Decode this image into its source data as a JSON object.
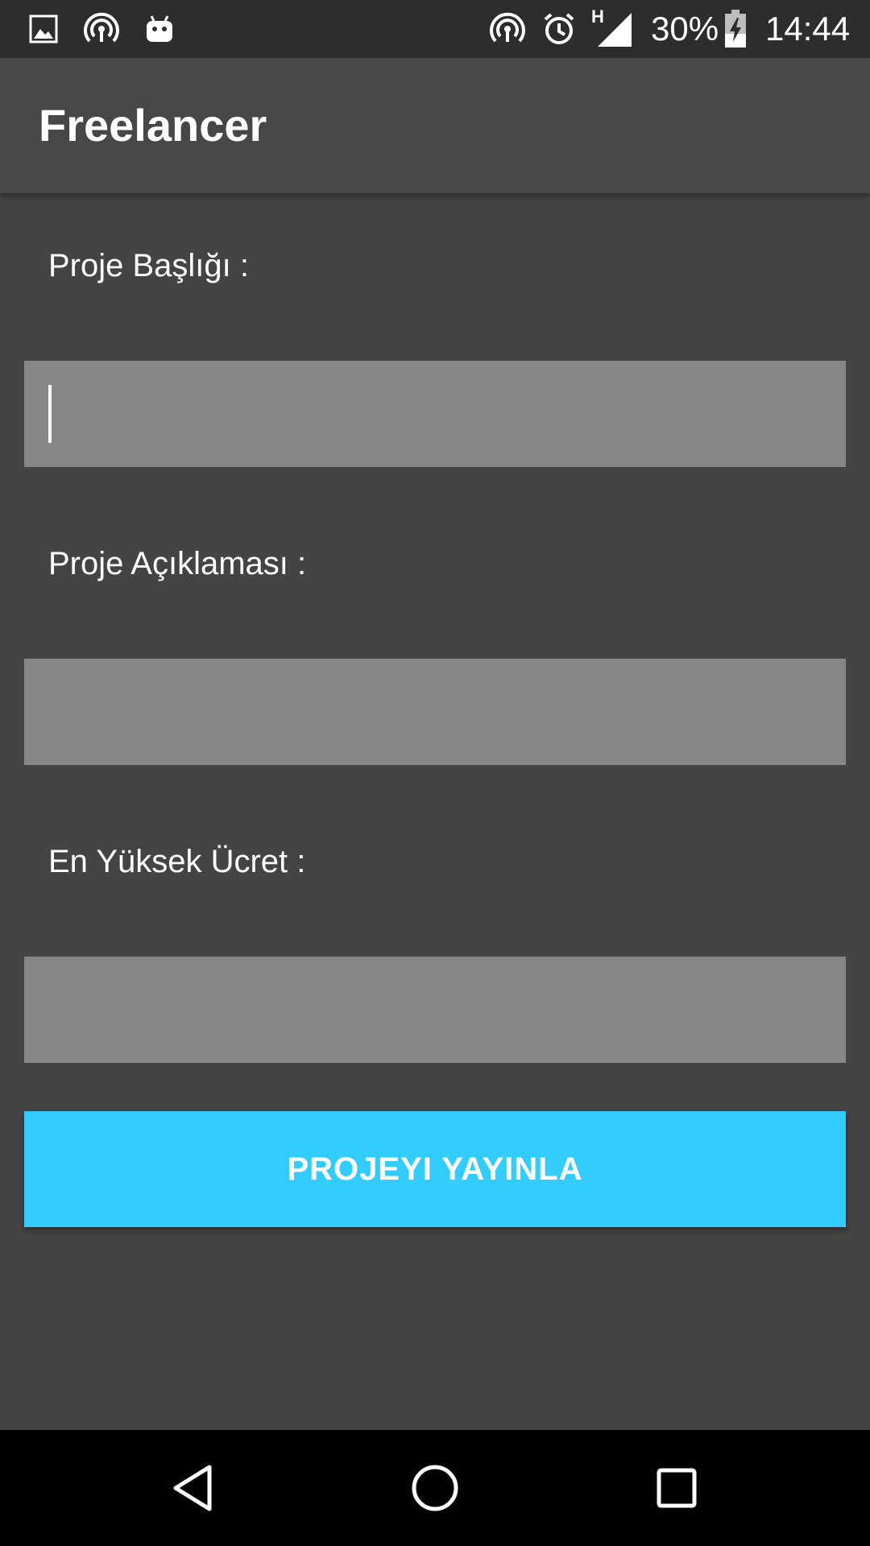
{
  "status_bar": {
    "icons": [
      "image-icon",
      "hotspot-icon",
      "android-debug-icon",
      "hotspot-icon",
      "alarm-icon",
      "signal-h-icon",
      "battery-charging-icon"
    ],
    "network_type": "H",
    "battery_percent": "30%",
    "time": "14:44"
  },
  "app_bar": {
    "title": "Freelancer"
  },
  "form": {
    "title_label": "Proje Başlığı :",
    "title_value": "",
    "description_label": "Proje Açıklaması :",
    "description_value": "",
    "max_fee_label": "En Yüksek Ücret :",
    "max_fee_value": ""
  },
  "publish_button": {
    "label": "PROJEYI YAYINLA"
  },
  "nav_bar": {
    "buttons": [
      "back-icon",
      "home-icon",
      "recents-icon"
    ]
  },
  "colors": {
    "background": "#444444",
    "status_bar": "#2d2d2d",
    "app_bar": "#474747",
    "input_fill": "#878787",
    "accent": "#33ccff",
    "nav_bar": "#000000"
  }
}
